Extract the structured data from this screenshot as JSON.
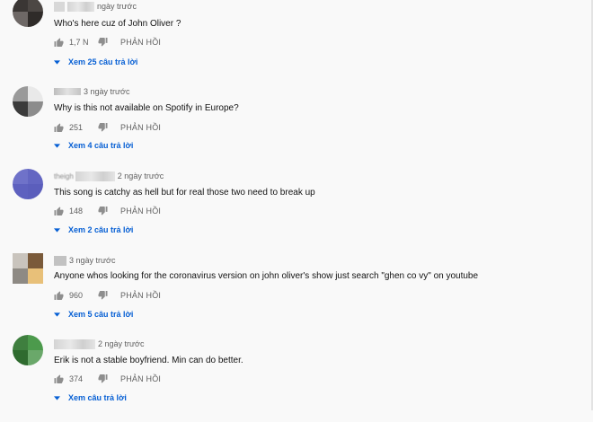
{
  "comments": [
    {
      "time": "ngày trước",
      "handle": "",
      "text": "Who's here cuz of John Oliver ?",
      "likes": "1,7 N",
      "reply_label": "PHẢN HỒI",
      "replies_label": "Xem 25 câu trả lời",
      "avatar_colors": [
        "#3a3634",
        "#4c4744",
        "#6e6866",
        "#2f2b29"
      ]
    },
    {
      "time": "3 ngày trước",
      "handle": "",
      "text": "Why is this not available on Spotify in Europe?",
      "likes": "251",
      "reply_label": "PHẢN HỒI",
      "replies_label": "Xem 4 câu trả lời",
      "avatar_colors": [
        "#9a9a9a",
        "#e9e9e9",
        "#3b3b3b",
        "#8c8c8c"
      ]
    },
    {
      "time": "2 ngày trước",
      "handle": "theigh",
      "text": "This song is catchy as hell but for real those two need to break up",
      "likes": "148",
      "reply_label": "PHẢN HỒI",
      "replies_label": "Xem 2 câu trả lời",
      "avatar_colors": [
        "#6f72c9",
        "#6366c2",
        "#5e61bf",
        "#5b5ebc"
      ]
    },
    {
      "time": "3 ngày trước",
      "handle": "",
      "text": "Anyone whos looking for the coronavirus version on john oliver's show just search \"ghen co vy\" on youtube",
      "likes": "960",
      "reply_label": "PHẢN HỒI",
      "replies_label": "Xem 5 câu trả lời",
      "avatar_colors": [
        "#c9c4bd",
        "#7a5a3a",
        "#8e8a84",
        "#e8c079"
      ]
    },
    {
      "time": "2 ngày trước",
      "handle": "",
      "text": "Erik is not a stable boyfriend.   Min can do better.",
      "likes": "374",
      "reply_label": "PHẢN HỒI",
      "replies_label": "Xem câu trả lời",
      "avatar_colors": [
        "#3f7f3f",
        "#4c9a4c",
        "#2f6b2f",
        "#6aa86a"
      ]
    }
  ]
}
